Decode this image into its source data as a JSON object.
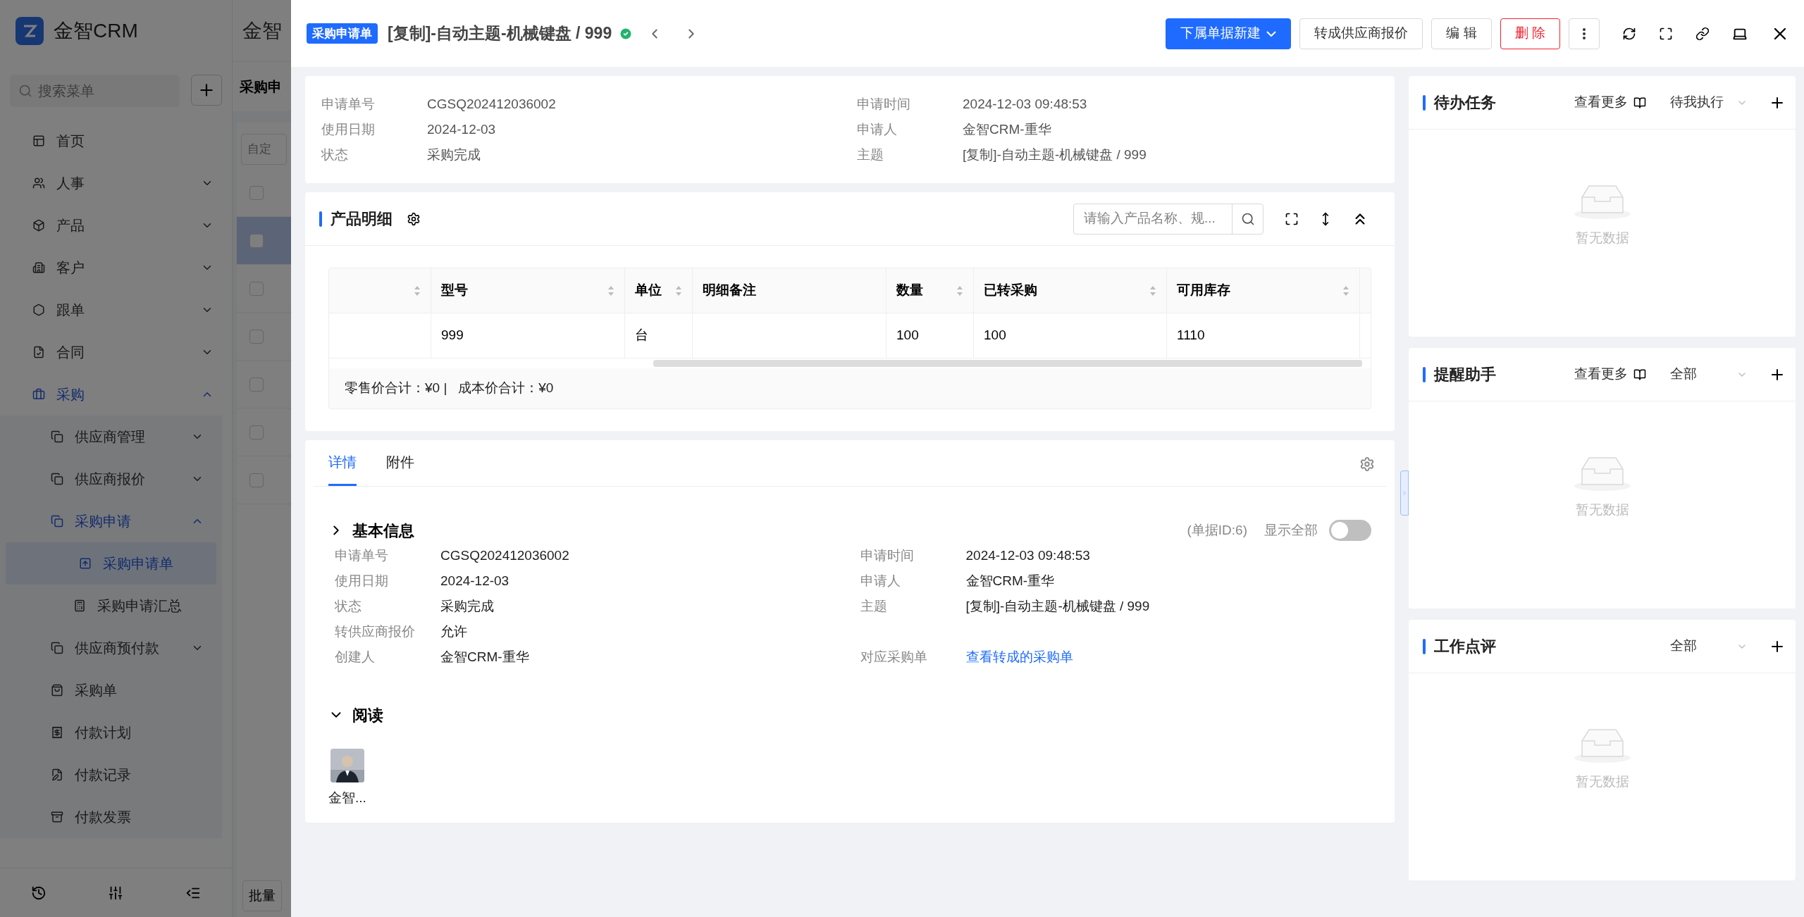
{
  "app": {
    "logo_text": "金智CRM",
    "search_placeholder": "搜索菜单",
    "topbar_text": "金智",
    "page_title": "采购申",
    "filter_placeholder": "自定",
    "bulk_button": "批量"
  },
  "sidebar": {
    "items": [
      {
        "label": "首页",
        "selected": false
      },
      {
        "label": "人事",
        "selected": false,
        "expanded": false
      },
      {
        "label": "产品",
        "selected": false,
        "expanded": false
      },
      {
        "label": "客户",
        "selected": false,
        "expanded": false
      },
      {
        "label": "跟单",
        "selected": false,
        "expanded": false
      },
      {
        "label": "合同",
        "selected": false,
        "expanded": false
      },
      {
        "label": "采购",
        "selected": false,
        "expanded": true,
        "children": [
          {
            "label": "供应商管理",
            "selected": false,
            "expanded": false
          },
          {
            "label": "供应商报价",
            "selected": false,
            "expanded": false
          },
          {
            "label": "采购申请",
            "selected": false,
            "expanded": true,
            "children": [
              {
                "label": "采购申请单",
                "selected": true
              },
              {
                "label": "采购申请汇总",
                "selected": false
              }
            ]
          },
          {
            "label": "供应商预付款",
            "selected": false,
            "expanded": false
          },
          {
            "label": "采购单",
            "selected": false
          },
          {
            "label": "付款计划",
            "selected": false
          },
          {
            "label": "付款记录",
            "selected": false
          },
          {
            "label": "付款发票",
            "selected": false
          }
        ]
      }
    ]
  },
  "background_rows": [
    {
      "selected": false,
      "checked": false
    },
    {
      "selected": true,
      "checked": false
    },
    {
      "selected": false,
      "checked": false
    },
    {
      "selected": false,
      "checked": false
    },
    {
      "selected": false,
      "checked": false
    },
    {
      "selected": false,
      "checked": false
    },
    {
      "selected": false,
      "checked": false
    }
  ],
  "drawer": {
    "badge": "采购申请单",
    "title": "[复制]-自动主题-机械键盘 / 999",
    "buttons": [
      {
        "label": "下属单据新建",
        "kind": "primary"
      },
      {
        "label": "转成供应商报价",
        "kind": "default"
      },
      {
        "label": "编 辑",
        "kind": "default"
      },
      {
        "label": "删 除",
        "kind": "danger"
      }
    ]
  },
  "summary": [
    [
      {
        "label": "申请单号",
        "value": "CGSQ202412036002"
      },
      {
        "label": "申请时间",
        "value": "2024-12-03 09:48:53"
      }
    ],
    [
      {
        "label": "使用日期",
        "value": "2024-12-03"
      },
      {
        "label": "申请人",
        "value": "金智CRM-重华"
      }
    ],
    [
      {
        "label": "状态",
        "value": "采购完成"
      },
      {
        "label": "主题",
        "value": "[复制]-自动主题-机械键盘 / 999"
      }
    ]
  ],
  "product_detail": {
    "title": "产品明细",
    "search_placeholder": "请输入产品名称、规...",
    "columns": [
      {
        "sortable": true
      },
      {
        "label": "型号",
        "sortable": true
      },
      {
        "label": "单位",
        "sortable": true
      },
      {
        "label": "明细备注",
        "sortable": false
      },
      {
        "label": "数量",
        "sortable": true
      },
      {
        "label": "已转采购",
        "sortable": true
      },
      {
        "label": "可用库存",
        "sortable": true
      }
    ],
    "rows": [
      [
        "",
        "999",
        "台",
        "",
        "100",
        "100",
        "1110"
      ]
    ],
    "totals": "零售价合计：¥0 |   成本价合计：¥0"
  },
  "tabs": [
    {
      "label": "详情",
      "selected": true
    },
    {
      "label": "附件",
      "selected": false
    }
  ],
  "basic_info": {
    "title": "基本信息",
    "expanded": false,
    "record_id": "(单据ID:6)",
    "show_all": {
      "label": "显示全部",
      "on": false
    },
    "rows": [
      [
        {
          "label": "申请单号",
          "value": "CGSQ202412036002"
        },
        {
          "label": "申请时间",
          "value": "2024-12-03 09:48:53"
        }
      ],
      [
        {
          "label": "使用日期",
          "value": "2024-12-03"
        },
        {
          "label": "申请人",
          "value": "金智CRM-重华"
        }
      ],
      [
        {
          "label": "状态",
          "value": "采购完成"
        },
        {
          "label": "主题",
          "value": "[复制]-自动主题-机械键盘 / 999"
        }
      ],
      [
        {
          "label": "转供应商报价",
          "value": "允许"
        }
      ],
      [
        {
          "label": "创建人",
          "value": "金智CRM-重华"
        },
        {
          "label": "对应采购单",
          "value": "查看转成的采购单",
          "kind": "link"
        }
      ]
    ]
  },
  "readers": {
    "title": "阅读",
    "expanded": true,
    "people": [
      {
        "name": "金智...",
        "kind": "picture"
      }
    ]
  },
  "panels": [
    {
      "title": "待办任务",
      "more": "查看更多",
      "filter": "待我执行",
      "empty": "暂无数据"
    },
    {
      "title": "提醒助手",
      "more": "查看更多",
      "filter": "全部",
      "empty": "暂无数据"
    },
    {
      "title": "工作点评",
      "filter": "全部",
      "empty": "暂无数据"
    }
  ]
}
